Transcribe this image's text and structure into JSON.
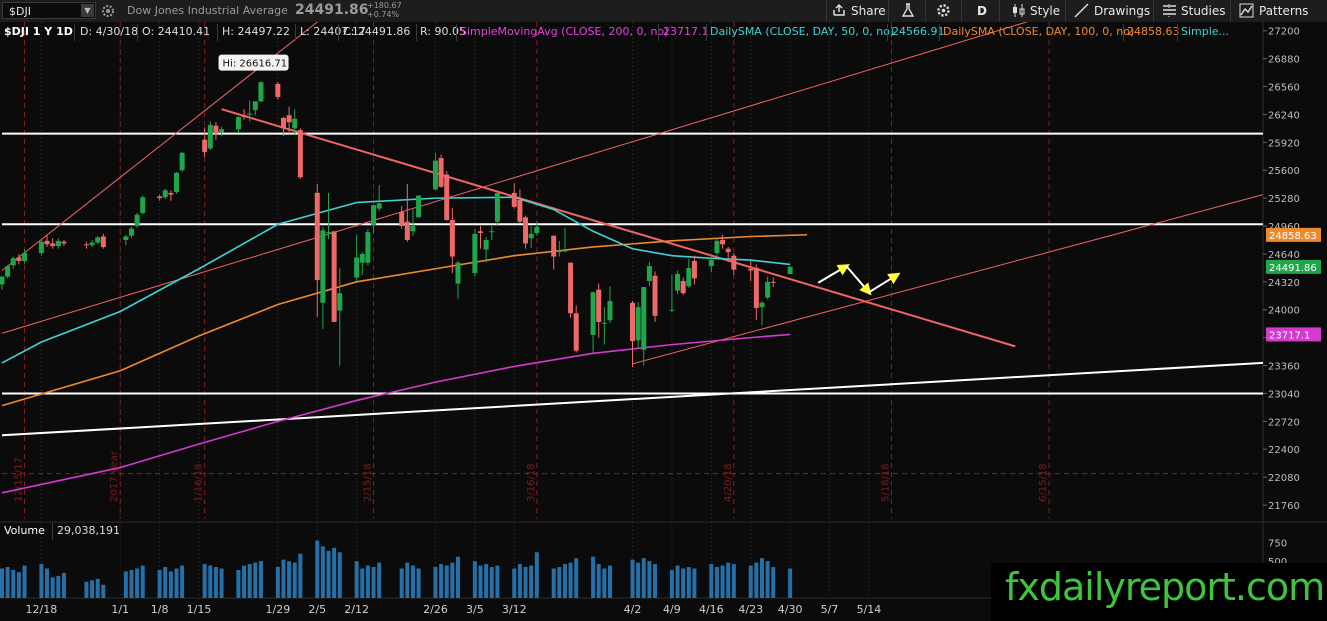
{
  "toolbar": {
    "symbol": "$DJI",
    "company": "Dow Jones Industrial Average",
    "last_price": "24491.86",
    "change": "+180.67",
    "change_pct": "+0.74%",
    "share_label": "Share",
    "period_label": "D",
    "style_label": "Style",
    "drawings_label": "Drawings",
    "studies_label": "Studies",
    "patterns_label": "Patterns"
  },
  "infobar": {
    "title": "$DJI 1 Y 1D",
    "date": "D: 4/30/18",
    "open": "O: 24410.41",
    "high": "H: 24497.22",
    "low": "L: 24407.17",
    "close": "C: 24491.86",
    "range": "R: 90.05",
    "sma200_label": "SimpleMovingAvg (CLOSE, 200, 0, no)",
    "sma200_value": "23717.1",
    "sma50_label": "DailySMA (CLOSE, DAY, 50, 0, no)",
    "sma50_value": "24566.91",
    "sma100_label": "DailySMA (CLOSE, DAY, 100, 0, no)",
    "sma100_value": "24858.63",
    "more_label": "Simple..."
  },
  "volume_panel": {
    "label": "Volume",
    "value": "29,038,191",
    "axis_labels": [
      "750",
      "500"
    ]
  },
  "watermark": "fxdailyreport.com",
  "colors": {
    "up": "#20a64a",
    "down": "#ee6969",
    "sma50": "#3fd3d3",
    "sma100": "#ef8a2c",
    "sma200": "#d23ad0",
    "trend": "#f06464",
    "level": "#ffffff",
    "volume": "#2570a8",
    "arrow": "#ffff33"
  },
  "chart_data": {
    "type": "candlestick",
    "title": "$DJI 1 Y 1D",
    "ylim": [
      21600,
      27300
    ],
    "y_ticks": [
      27200,
      26880,
      26560,
      26240,
      25920,
      25600,
      25280,
      24960,
      24640,
      24320,
      24000,
      23680,
      23360,
      23040,
      22720,
      22400,
      22080,
      21760
    ],
    "x_ticks": [
      "12/18",
      "1/1",
      "1/8",
      "1/15",
      "1/29",
      "2/5",
      "2/12",
      "2/26",
      "3/5",
      "3/12",
      "4/2",
      "4/9",
      "4/16",
      "4/23",
      "4/30",
      "5/7",
      "5/14"
    ],
    "x_tick_days": [
      0,
      14,
      21,
      28,
      42,
      49,
      56,
      70,
      77,
      84,
      105,
      112,
      119,
      126,
      133,
      140,
      147
    ],
    "x_range_days": [
      -7,
      217
    ],
    "x_day0": "12/18",
    "vertical_markers": [
      {
        "label": "12/15/17",
        "day": -3
      },
      {
        "label": "2017 year",
        "day": 14
      },
      {
        "label": "1/16/18",
        "day": 29
      },
      {
        "label": "2/15/18",
        "day": 59
      },
      {
        "label": "3/16/18",
        "day": 88
      },
      {
        "label": "4/20/18",
        "day": 123
      },
      {
        "label": "5/18/18",
        "day": 151
      },
      {
        "label": "6/15/18",
        "day": 179
      }
    ],
    "hi_label": "Hi: 26616.71",
    "last_value_label": "24491.86",
    "price_labels": [
      {
        "text": "24858.63",
        "price": 24858.63,
        "series": "sma100"
      },
      {
        "text": "24491.86",
        "price": 24491.86,
        "series": "last"
      },
      {
        "text": "23717.1",
        "price": 23717.1,
        "series": "sma200"
      }
    ],
    "candles": [
      {
        "date": "12/11",
        "o": 24290,
        "h": 24390,
        "l": 24230,
        "c": 24380
      },
      {
        "date": "12/12",
        "o": 24380,
        "h": 24510,
        "l": 24360,
        "c": 24500
      },
      {
        "date": "12/13",
        "o": 24510,
        "h": 24610,
        "l": 24470,
        "c": 24590
      },
      {
        "date": "12/14",
        "o": 24600,
        "h": 24640,
        "l": 24520,
        "c": 24560
      },
      {
        "date": "12/15",
        "o": 24560,
        "h": 24690,
        "l": 24530,
        "c": 24650
      },
      {
        "date": "12/18",
        "o": 24650,
        "h": 24810,
        "l": 24620,
        "c": 24780
      },
      {
        "date": "12/19",
        "o": 24790,
        "h": 24860,
        "l": 24720,
        "c": 24750
      },
      {
        "date": "12/20",
        "o": 24760,
        "h": 24820,
        "l": 24700,
        "c": 24730
      },
      {
        "date": "12/21",
        "o": 24730,
        "h": 24820,
        "l": 24700,
        "c": 24790
      },
      {
        "date": "12/22",
        "o": 24780,
        "h": 24800,
        "l": 24730,
        "c": 24760
      },
      {
        "date": "12/26",
        "o": 24750,
        "h": 24780,
        "l": 24700,
        "c": 24740
      },
      {
        "date": "12/27",
        "o": 24740,
        "h": 24800,
        "l": 24720,
        "c": 24770
      },
      {
        "date": "12/28",
        "o": 24770,
        "h": 24840,
        "l": 24750,
        "c": 24830
      },
      {
        "date": "12/29",
        "o": 24840,
        "h": 24870,
        "l": 24700,
        "c": 24720
      },
      {
        "date": "1/2",
        "o": 24800,
        "h": 24860,
        "l": 24740,
        "c": 24840
      },
      {
        "date": "1/3",
        "o": 24850,
        "h": 24950,
        "l": 24820,
        "c": 24930
      },
      {
        "date": "1/4",
        "o": 24960,
        "h": 25110,
        "l": 24940,
        "c": 25090
      },
      {
        "date": "1/5",
        "o": 25110,
        "h": 25310,
        "l": 25090,
        "c": 25290
      },
      {
        "date": "1/8",
        "o": 25300,
        "h": 25320,
        "l": 25250,
        "c": 25280
      },
      {
        "date": "1/9",
        "o": 25290,
        "h": 25390,
        "l": 25270,
        "c": 25370
      },
      {
        "date": "1/10",
        "o": 25340,
        "h": 25370,
        "l": 25250,
        "c": 25320
      },
      {
        "date": "1/11",
        "o": 25350,
        "h": 25580,
        "l": 25330,
        "c": 25570
      },
      {
        "date": "1/12",
        "o": 25600,
        "h": 25810,
        "l": 25580,
        "c": 25800
      },
      {
        "date": "1/16",
        "o": 25950,
        "h": 26090,
        "l": 25750,
        "c": 25810
      },
      {
        "date": "1/17",
        "o": 25850,
        "h": 26160,
        "l": 25830,
        "c": 26120
      },
      {
        "date": "1/18",
        "o": 26110,
        "h": 26150,
        "l": 25950,
        "c": 26020
      },
      {
        "date": "1/19",
        "o": 26030,
        "h": 26100,
        "l": 25990,
        "c": 26070
      },
      {
        "date": "1/22",
        "o": 26070,
        "h": 26220,
        "l": 26030,
        "c": 26210
      },
      {
        "date": "1/23",
        "o": 26230,
        "h": 26300,
        "l": 26180,
        "c": 26210
      },
      {
        "date": "1/24",
        "o": 26250,
        "h": 26400,
        "l": 26160,
        "c": 26250
      },
      {
        "date": "1/25",
        "o": 26290,
        "h": 26380,
        "l": 26230,
        "c": 26390
      },
      {
        "date": "1/26",
        "o": 26390,
        "h": 26620,
        "l": 26380,
        "c": 26610
      },
      {
        "date": "1/29",
        "o": 26590,
        "h": 26610,
        "l": 26410,
        "c": 26440
      },
      {
        "date": "1/30",
        "o": 26200,
        "h": 26210,
        "l": 25990,
        "c": 26080
      },
      {
        "date": "1/31",
        "o": 26230,
        "h": 26330,
        "l": 26020,
        "c": 26150
      },
      {
        "date": "2/1",
        "o": 26080,
        "h": 26300,
        "l": 26000,
        "c": 26190
      },
      {
        "date": "2/2",
        "o": 26060,
        "h": 26080,
        "l": 25500,
        "c": 25520
      },
      {
        "date": "2/5",
        "o": 25340,
        "h": 25440,
        "l": 23920,
        "c": 24340
      },
      {
        "date": "2/6",
        "o": 24080,
        "h": 24950,
        "l": 23780,
        "c": 24910
      },
      {
        "date": "2/7",
        "o": 24890,
        "h": 25340,
        "l": 24810,
        "c": 24890
      },
      {
        "date": "2/8",
        "o": 24900,
        "h": 24900,
        "l": 23860,
        "c": 23860
      },
      {
        "date": "2/9",
        "o": 23990,
        "h": 24480,
        "l": 23360,
        "c": 24190
      },
      {
        "date": "2/12",
        "o": 24370,
        "h": 24860,
        "l": 24330,
        "c": 24600
      },
      {
        "date": "2/13",
        "o": 24540,
        "h": 24660,
        "l": 24400,
        "c": 24640
      },
      {
        "date": "2/14",
        "o": 24540,
        "h": 24930,
        "l": 24510,
        "c": 24890
      },
      {
        "date": "2/15",
        "o": 24970,
        "h": 25200,
        "l": 24880,
        "c": 25200
      },
      {
        "date": "2/16",
        "o": 25160,
        "h": 25430,
        "l": 25130,
        "c": 25220
      },
      {
        "date": "2/20",
        "o": 25120,
        "h": 25190,
        "l": 24930,
        "c": 24960
      },
      {
        "date": "2/21",
        "o": 25010,
        "h": 25440,
        "l": 24780,
        "c": 24800
      },
      {
        "date": "2/22",
        "o": 24900,
        "h": 25150,
        "l": 24850,
        "c": 24960
      },
      {
        "date": "2/23",
        "o": 25060,
        "h": 25310,
        "l": 25060,
        "c": 25310
      },
      {
        "date": "2/26",
        "o": 25380,
        "h": 25800,
        "l": 25370,
        "c": 25710
      },
      {
        "date": "2/27",
        "o": 25740,
        "h": 25780,
        "l": 25400,
        "c": 25410
      },
      {
        "date": "2/28",
        "o": 25550,
        "h": 25590,
        "l": 25020,
        "c": 25030
      },
      {
        "date": "3/1",
        "o": 25030,
        "h": 25170,
        "l": 24420,
        "c": 24610
      },
      {
        "date": "3/2",
        "o": 24300,
        "h": 24560,
        "l": 24130,
        "c": 24540
      },
      {
        "date": "3/5",
        "o": 24420,
        "h": 24930,
        "l": 24380,
        "c": 24870
      },
      {
        "date": "3/6",
        "o": 24900,
        "h": 24960,
        "l": 24700,
        "c": 24880
      },
      {
        "date": "3/7",
        "o": 24690,
        "h": 24830,
        "l": 24540,
        "c": 24800
      },
      {
        "date": "3/8",
        "o": 24900,
        "h": 24960,
        "l": 24800,
        "c": 24900
      },
      {
        "date": "3/9",
        "o": 25010,
        "h": 25330,
        "l": 24960,
        "c": 25340
      },
      {
        "date": "3/12",
        "o": 25340,
        "h": 25450,
        "l": 25160,
        "c": 25180
      },
      {
        "date": "3/13",
        "o": 25260,
        "h": 25380,
        "l": 24990,
        "c": 25010
      },
      {
        "date": "3/14",
        "o": 25060,
        "h": 25080,
        "l": 24700,
        "c": 24760
      },
      {
        "date": "3/15",
        "o": 24820,
        "h": 24960,
        "l": 24710,
        "c": 24870
      },
      {
        "date": "3/16",
        "o": 24880,
        "h": 25010,
        "l": 24850,
        "c": 24950
      },
      {
        "date": "3/19",
        "o": 24850,
        "h": 24850,
        "l": 24460,
        "c": 24610
      },
      {
        "date": "3/20",
        "o": 24660,
        "h": 24790,
        "l": 24610,
        "c": 24680
      },
      {
        "date": "3/21",
        "o": 24680,
        "h": 24940,
        "l": 24660,
        "c": 24680
      },
      {
        "date": "3/22",
        "o": 24540,
        "h": 24540,
        "l": 23910,
        "c": 23960
      },
      {
        "date": "3/23",
        "o": 23960,
        "h": 24050,
        "l": 23510,
        "c": 23530
      },
      {
        "date": "3/26",
        "o": 23710,
        "h": 24210,
        "l": 23510,
        "c": 24200
      },
      {
        "date": "3/27",
        "o": 24230,
        "h": 24300,
        "l": 23680,
        "c": 23860
      },
      {
        "date": "3/28",
        "o": 23850,
        "h": 24030,
        "l": 23600,
        "c": 23850
      },
      {
        "date": "3/29",
        "o": 23880,
        "h": 24270,
        "l": 23850,
        "c": 24100
      },
      {
        "date": "4/2",
        "o": 24080,
        "h": 24100,
        "l": 23340,
        "c": 23640
      },
      {
        "date": "4/3",
        "o": 23650,
        "h": 24090,
        "l": 23560,
        "c": 24030
      },
      {
        "date": "4/4",
        "o": 23540,
        "h": 24260,
        "l": 23360,
        "c": 24260
      },
      {
        "date": "4/5",
        "o": 24330,
        "h": 24550,
        "l": 24270,
        "c": 24500
      },
      {
        "date": "4/6",
        "o": 24390,
        "h": 24440,
        "l": 23860,
        "c": 23930
      },
      {
        "date": "4/9",
        "o": 24000,
        "h": 24400,
        "l": 23970,
        "c": 24000
      },
      {
        "date": "4/10",
        "o": 24220,
        "h": 24450,
        "l": 24180,
        "c": 24410
      },
      {
        "date": "4/11",
        "o": 24330,
        "h": 24370,
        "l": 24170,
        "c": 24190
      },
      {
        "date": "4/12",
        "o": 24270,
        "h": 24580,
        "l": 24250,
        "c": 24480
      },
      {
        "date": "4/13",
        "o": 24560,
        "h": 24620,
        "l": 24290,
        "c": 24360
      },
      {
        "date": "4/16",
        "o": 24500,
        "h": 24640,
        "l": 24430,
        "c": 24570
      },
      {
        "date": "4/17",
        "o": 24650,
        "h": 24830,
        "l": 24620,
        "c": 24790
      },
      {
        "date": "4/18",
        "o": 24800,
        "h": 24860,
        "l": 24700,
        "c": 24750
      },
      {
        "date": "4/19",
        "o": 24700,
        "h": 24720,
        "l": 24550,
        "c": 24660
      },
      {
        "date": "4/20",
        "o": 24620,
        "h": 24650,
        "l": 24400,
        "c": 24460
      },
      {
        "date": "4/23",
        "o": 24470,
        "h": 24560,
        "l": 24330,
        "c": 24450
      },
      {
        "date": "4/24",
        "o": 24480,
        "h": 24520,
        "l": 23880,
        "c": 24020
      },
      {
        "date": "4/25",
        "o": 24030,
        "h": 24100,
        "l": 23820,
        "c": 24080
      },
      {
        "date": "4/26",
        "o": 24140,
        "h": 24380,
        "l": 24120,
        "c": 24320
      },
      {
        "date": "4/27",
        "o": 24320,
        "h": 24370,
        "l": 24260,
        "c": 24310
      },
      {
        "date": "4/30",
        "o": 24410.41,
        "h": 24497.22,
        "l": 24407.17,
        "c": 24491.86
      }
    ],
    "volume": [
      40,
      42,
      38,
      35,
      44,
      46,
      40,
      28,
      30,
      34,
      22,
      24,
      26,
      18,
      36,
      38,
      40,
      44,
      38,
      42,
      36,
      40,
      44,
      46,
      44,
      42,
      40,
      38,
      44,
      46,
      48,
      50,
      42,
      52,
      50,
      48,
      60,
      78,
      70,
      64,
      68,
      62,
      50,
      40,
      44,
      42,
      48,
      40,
      48,
      44,
      40,
      42,
      46,
      44,
      48,
      56,
      50,
      44,
      46,
      42,
      44,
      40,
      46,
      42,
      44,
      62,
      40,
      42,
      46,
      48,
      54,
      56,
      46,
      40,
      44,
      52,
      48,
      54,
      50,
      46,
      38,
      44,
      40,
      42,
      40,
      46,
      42,
      44,
      48,
      46,
      44,
      48,
      54,
      50,
      42,
      40,
      36
    ],
    "sma50": [
      [
        -7,
        23390
      ],
      [
        0,
        23630
      ],
      [
        14,
        23980
      ],
      [
        28,
        24470
      ],
      [
        42,
        24980
      ],
      [
        56,
        25230
      ],
      [
        70,
        25280
      ],
      [
        84,
        25290
      ],
      [
        91,
        25150
      ],
      [
        98,
        24900
      ],
      [
        105,
        24700
      ],
      [
        112,
        24620
      ],
      [
        119,
        24590
      ],
      [
        126,
        24570
      ],
      [
        133,
        24520
      ]
    ],
    "sma100": [
      [
        -7,
        22900
      ],
      [
        14,
        23300
      ],
      [
        28,
        23700
      ],
      [
        42,
        24060
      ],
      [
        56,
        24320
      ],
      [
        70,
        24470
      ],
      [
        84,
        24620
      ],
      [
        98,
        24720
      ],
      [
        112,
        24790
      ],
      [
        126,
        24840
      ],
      [
        136,
        24860
      ]
    ],
    "sma200": [
      [
        -7,
        21900
      ],
      [
        14,
        22190
      ],
      [
        28,
        22460
      ],
      [
        42,
        22720
      ],
      [
        56,
        22960
      ],
      [
        70,
        23170
      ],
      [
        84,
        23350
      ],
      [
        98,
        23500
      ],
      [
        112,
        23600
      ],
      [
        126,
        23680
      ],
      [
        133,
        23717
      ]
    ],
    "trendlines": [
      {
        "name": "resistance",
        "color": "trend",
        "width": 2,
        "p1": [
          32,
          26300
        ],
        "p2": [
          173,
          23580
        ]
      },
      {
        "name": "channel-top",
        "color": "trend",
        "width": 1,
        "p1": [
          -7,
          24450
        ],
        "p2": [
          49,
          27300
        ]
      },
      {
        "name": "channel-bottom",
        "color": "trend",
        "width": 1,
        "p1": [
          -7,
          23730
        ],
        "p2": [
          175,
          27300
        ]
      },
      {
        "name": "support-rising",
        "color": "trend",
        "width": 1,
        "p1": [
          105,
          23380
        ],
        "p2": [
          217,
          25320
        ]
      },
      {
        "name": "long-term-support",
        "color": "level",
        "width": 2,
        "p1": [
          -7,
          22560
        ],
        "p2": [
          217,
          23390
        ]
      }
    ],
    "horizontal_levels": [
      26020,
      24980,
      23040
    ],
    "arrows": [
      [
        [
          138,
          24310
        ],
        [
          143,
          24500
        ]
      ],
      [
        [
          143,
          24500
        ],
        [
          147,
          24200
        ]
      ],
      [
        [
          147,
          24200
        ],
        [
          152,
          24400
        ]
      ]
    ],
    "hi_point": {
      "day": 32,
      "price": 26616.71
    }
  }
}
